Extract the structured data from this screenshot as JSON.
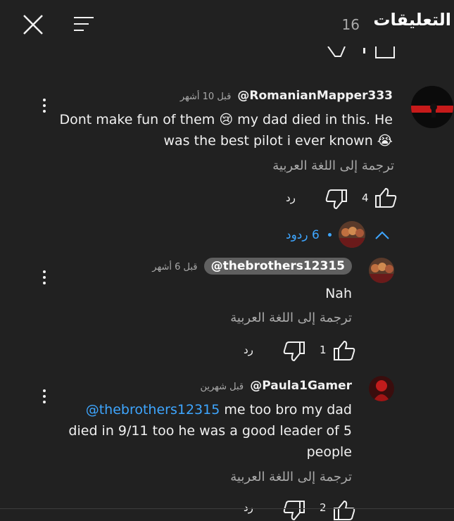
{
  "header": {
    "title": "التعليقات",
    "count": "16"
  },
  "comments": [
    {
      "handle": "@RomanianMapper333",
      "time": "قبل 10 أشهر",
      "text_line1": "Dont make fun of them 😢  my dad died in this. He",
      "text_line2": "was the best pilot i ever known 😭",
      "translate": "ترجمة إلى اللغة العربية",
      "likes": "4",
      "reply_label": "رد",
      "replies_link": "6 ردود"
    },
    {
      "handle": "@thebrothers12315",
      "time": "قبل 6 أشهر",
      "text": "Nah",
      "translate": "ترجمة إلى اللغة العربية",
      "likes": "1",
      "reply_label": "رد"
    },
    {
      "handle": "@Paula1Gamer",
      "time": "قبل شهرين",
      "mention": "@thebrothers12315",
      "text_line1": " me too bro my dad",
      "text_line2": "died in 9/11 too he was a good leader of 5",
      "text_line3": "people",
      "translate": "ترجمة إلى اللغة العربية",
      "likes": "2",
      "reply_label": "رد"
    }
  ],
  "colors": {
    "background": "#212121",
    "text": "#f1f1f1",
    "secondary": "#aaaaaa",
    "link": "#3ea6ff"
  }
}
